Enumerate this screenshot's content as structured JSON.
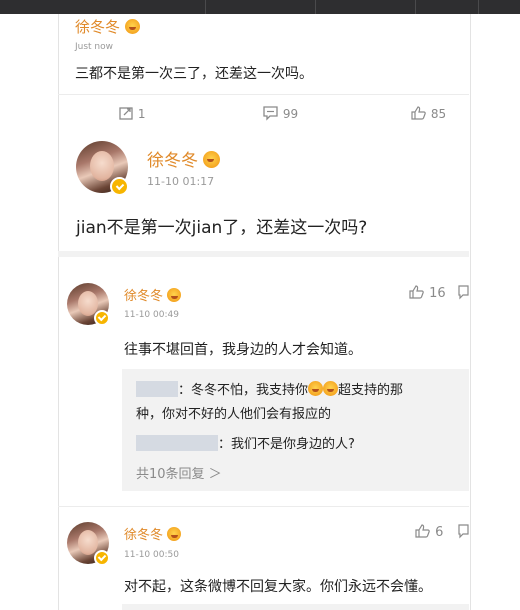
{
  "top_comment": {
    "name": "徐冬冬",
    "time": "Just now",
    "text": "三都不是第一次三了，还差这一次吗。"
  },
  "actions": {
    "repost_count": "1",
    "comment_count": "99",
    "like_count": "85"
  },
  "post": {
    "name": "徐冬冬",
    "time": "11-10 01:17",
    "text": "jian不是第一次jian了，还差这一次吗?"
  },
  "comments": [
    {
      "name": "徐冬冬",
      "time": "11-10 00:49",
      "likes": "16",
      "text": "往事不堪回首，我身边的人才会知道。",
      "replies": [
        {
          "text_a": "：冬冬不怕，我支持你",
          "text_b": "超支持的那",
          "text_c": "种，你对不好的人他们会有报应的"
        },
        {
          "text_a": "：我们不是你身边的人?"
        }
      ],
      "more_replies": "共10条回复 ＞"
    },
    {
      "name": "徐冬冬",
      "time": "11-10 00:50",
      "likes": "6",
      "text": "对不起，这条微博不回复大家。你们永远不会懂。"
    }
  ],
  "colors": {
    "name": "#e08a2a",
    "badge": "#f7b500",
    "link_gray": "#8a8a8a"
  },
  "icons": [
    "repost-icon",
    "comment-icon",
    "thumbs-up-icon",
    "reply-icon",
    "verified-badge-icon",
    "emoji-icon"
  ]
}
